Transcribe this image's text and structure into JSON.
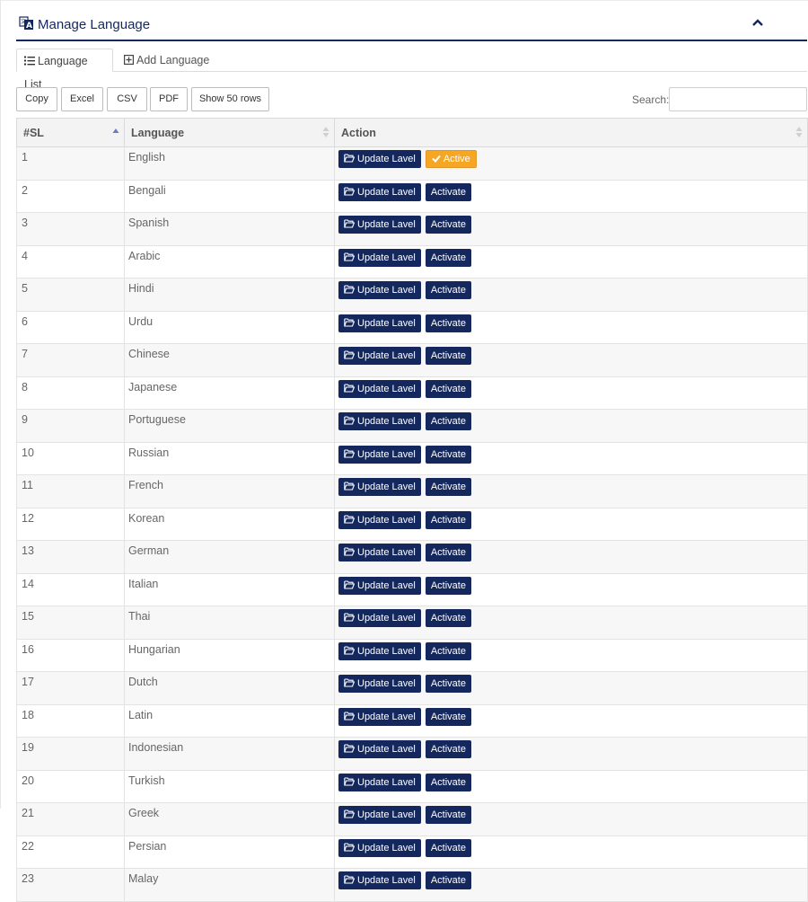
{
  "header": {
    "title": "Manage Language"
  },
  "tabs": [
    {
      "label": "Language List"
    },
    {
      "label": "Add Language"
    }
  ],
  "toolbar": {
    "buttons": [
      "Copy",
      "Excel",
      "CSV",
      "PDF",
      "Show 50 rows"
    ],
    "search_label": "Search:",
    "search_value": ""
  },
  "table": {
    "columns": [
      "#SL",
      "Language",
      "Action"
    ],
    "update_label": "Update Lavel",
    "activate_label": "Activate",
    "active_label": "Active",
    "rows": [
      {
        "sl": "1",
        "language": "English",
        "active": true
      },
      {
        "sl": "2",
        "language": "Bengali",
        "active": false
      },
      {
        "sl": "3",
        "language": "Spanish",
        "active": false
      },
      {
        "sl": "4",
        "language": "Arabic",
        "active": false
      },
      {
        "sl": "5",
        "language": "Hindi",
        "active": false
      },
      {
        "sl": "6",
        "language": "Urdu",
        "active": false
      },
      {
        "sl": "7",
        "language": "Chinese",
        "active": false
      },
      {
        "sl": "8",
        "language": "Japanese",
        "active": false
      },
      {
        "sl": "9",
        "language": "Portuguese",
        "active": false
      },
      {
        "sl": "10",
        "language": "Russian",
        "active": false
      },
      {
        "sl": "11",
        "language": "French",
        "active": false
      },
      {
        "sl": "12",
        "language": "Korean",
        "active": false
      },
      {
        "sl": "13",
        "language": "German",
        "active": false
      },
      {
        "sl": "14",
        "language": "Italian",
        "active": false
      },
      {
        "sl": "15",
        "language": "Thai",
        "active": false
      },
      {
        "sl": "16",
        "language": "Hungarian",
        "active": false
      },
      {
        "sl": "17",
        "language": "Dutch",
        "active": false
      },
      {
        "sl": "18",
        "language": "Latin",
        "active": false
      },
      {
        "sl": "19",
        "language": "Indonesian",
        "active": false
      },
      {
        "sl": "20",
        "language": "Turkish",
        "active": false
      },
      {
        "sl": "21",
        "language": "Greek",
        "active": false
      },
      {
        "sl": "22",
        "language": "Persian",
        "active": false
      },
      {
        "sl": "23",
        "language": "Malay",
        "active": false
      }
    ]
  },
  "colors": {
    "primary": "#14285e",
    "active": "#f5a623"
  },
  "icons": [
    "translate-icon",
    "chevron-up-icon",
    "list-icon",
    "plus-square-icon",
    "folder-open-icon",
    "check-icon",
    "sort-asc-icon",
    "sort-icon"
  ]
}
